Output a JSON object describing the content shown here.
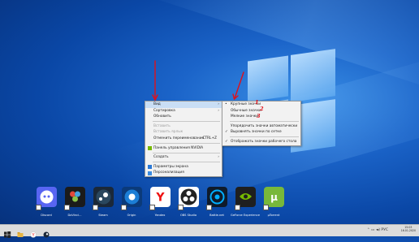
{
  "context_menu": {
    "items": [
      {
        "label": "Вид",
        "submenu": true,
        "highlighted": true
      },
      {
        "label": "Сортировка",
        "submenu": true
      },
      {
        "label": "Обновить"
      },
      {
        "separator": true
      },
      {
        "label": "Вставить",
        "disabled": true
      },
      {
        "label": "Вставить ярлык",
        "disabled": true
      },
      {
        "label": "Отменить переименование",
        "shortcut": "CTRL+Z"
      },
      {
        "separator": true
      },
      {
        "label": "Панель управления NVIDIA",
        "icon": "nvidia-icon"
      },
      {
        "separator": true
      },
      {
        "label": "Создать",
        "submenu": true
      },
      {
        "separator": true
      },
      {
        "label": "Параметры экрана",
        "icon": "display-settings-icon"
      },
      {
        "label": "Персонализация",
        "icon": "personalize-icon"
      }
    ]
  },
  "view_submenu": {
    "items": [
      {
        "label": "Крупные значки",
        "selected": true
      },
      {
        "label": "Обычные значки"
      },
      {
        "label": "Мелкие значки"
      },
      {
        "separator": true
      },
      {
        "label": "Упорядочить значки автоматически"
      },
      {
        "label": "Выровнять значки по сетке",
        "checked": true
      },
      {
        "separator": true
      },
      {
        "label": "Отображать значки рабочего стола",
        "checked": true
      }
    ]
  },
  "annotations": {
    "n1": "1",
    "n2": "2",
    "n3": "3",
    "color": "#e0101a"
  },
  "desktop_icons": [
    {
      "name": "discord-icon",
      "label": "Discord",
      "color": "#5865f2"
    },
    {
      "name": "davinci-resolve-icon",
      "label": "DaVinci...",
      "color": "#1b1b1b"
    },
    {
      "name": "steam-icon",
      "label": "Steam",
      "color": "#1b2838"
    },
    {
      "name": "origin-icon",
      "label": "Origin",
      "color": "#0b3a7a"
    },
    {
      "name": "yandex-browser-icon",
      "label": "Yandex",
      "color": "#ffffff"
    },
    {
      "name": "obs-studio-icon",
      "label": "OBS Studio",
      "color": "#ffffff"
    },
    {
      "name": "battlenet-icon",
      "label": "Battle.net",
      "color": "#0f1b2b"
    },
    {
      "name": "geforce-experience-icon",
      "label": "GeForce Experience",
      "color": "#1f1f1f"
    },
    {
      "name": "utorrent-icon",
      "label": "µTorrent",
      "color": "#78b83a"
    }
  ],
  "taskbar": {
    "tray_time": "15:03",
    "tray_date": "16.01.2020",
    "language": "РУС"
  }
}
